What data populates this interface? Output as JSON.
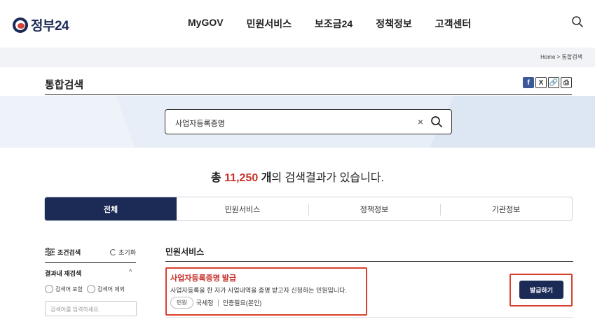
{
  "header": {
    "logo_text": "정부24",
    "nav": [
      "MyGOV",
      "민원서비스",
      "보조금24",
      "정책정보",
      "고객센터"
    ],
    "search_icon": "search-icon"
  },
  "breadcrumb": "Home > 통합검색",
  "page": {
    "title": "통합검색",
    "share_icons": [
      "facebook-icon",
      "x-icon",
      "link-icon",
      "print-icon"
    ],
    "share_labels": {
      "facebook": "f",
      "x": "X",
      "link": "🔗",
      "print": "⎙"
    }
  },
  "search": {
    "value": "사업자등록증명",
    "clear_label": "×"
  },
  "results": {
    "prefix": "총 ",
    "count": "11,250",
    "unit": " 개",
    "suffix": "의 검색결과가 있습니다."
  },
  "tabs": [
    {
      "label": "전체",
      "active": true
    },
    {
      "label": "민원서비스",
      "active": false
    },
    {
      "label": "정책정보",
      "active": false
    },
    {
      "label": "기관정보",
      "active": false
    }
  ],
  "filter": {
    "title": "조건검색",
    "reset_label": "초기화",
    "refine_label": "결과내 재검색",
    "refine_chevron": "^",
    "radio_include": "검색어 포함",
    "radio_exclude": "검색어 제외",
    "input_placeholder": "검색어를 입력하세요."
  },
  "section": {
    "title": "민원서비스",
    "item": {
      "title": "사업자등록증명 발급",
      "desc": "사업자등록을 한 자가 사업내역을 증명 받고자 신청하는 민원입니다.",
      "tag": "민원",
      "agency": "국세청",
      "auth": "인증필요(본인)",
      "issue_button": "발급하기"
    }
  },
  "colors": {
    "navy": "#1c2a56",
    "accent_red": "#c8332b",
    "highlight_red": "#d8402c"
  }
}
